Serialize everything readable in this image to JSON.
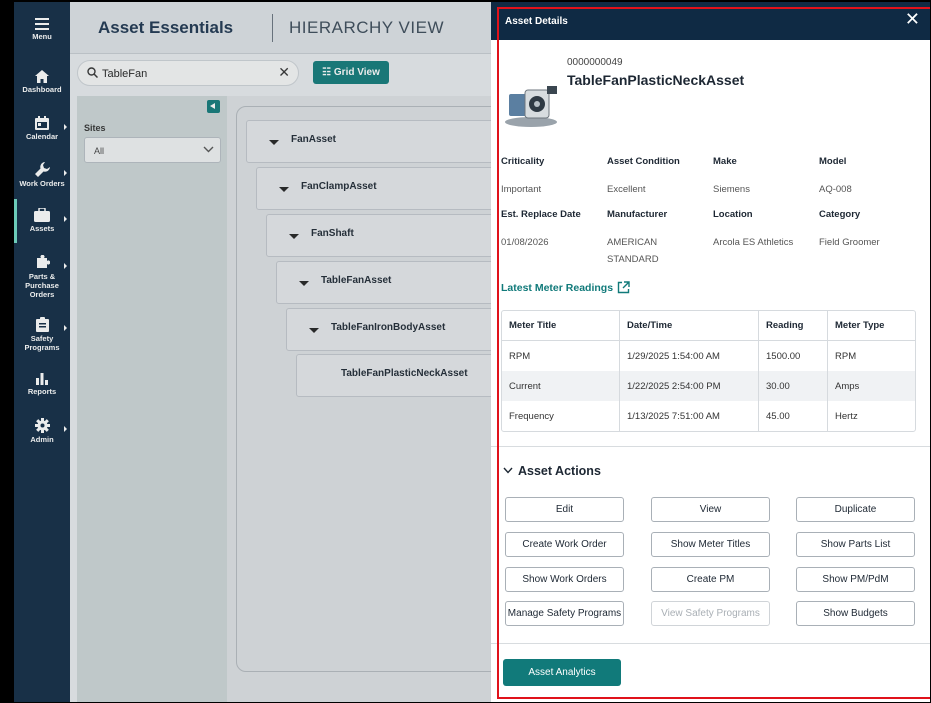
{
  "sidebar": {
    "menu": "Menu",
    "items": [
      {
        "label": "Dashboard",
        "icon": "home-icon"
      },
      {
        "label": "Calendar",
        "icon": "calendar-icon"
      },
      {
        "label": "Work Orders",
        "icon": "wrench-icon"
      },
      {
        "label": "Assets",
        "icon": "briefcase-icon"
      },
      {
        "label": "Parts & Purchase Orders",
        "icon": "puzzle-icon"
      },
      {
        "label": "Safety Programs",
        "icon": "clipboard-icon"
      },
      {
        "label": "Reports",
        "icon": "bar-chart-icon"
      },
      {
        "label": "Admin",
        "icon": "gear-icon"
      }
    ]
  },
  "header": {
    "app_title": "Asset Essentials",
    "view_title": "HIERARCHY VIEW"
  },
  "toolbar": {
    "search_value": "TableFan",
    "clear": "✕",
    "grid_view": "☷ Grid View"
  },
  "filters": {
    "sites_label": "Sites",
    "sites_value": "All"
  },
  "hierarchy": [
    "FanAsset",
    "FanClampAsset",
    "FanShaft",
    "TableFanAsset",
    "TableFanIronBodyAsset",
    "TableFanPlasticNeckAsset"
  ],
  "details": {
    "title": "Asset Details",
    "close": "✕",
    "asset_number": "0000000049",
    "asset_name": "TableFanPlasticNeckAsset",
    "fields": [
      {
        "label": "Criticality",
        "value": "Important"
      },
      {
        "label": "Asset Condition",
        "value": "Excellent"
      },
      {
        "label": "Make",
        "value": "Siemens"
      },
      {
        "label": "Model",
        "value": "AQ-008"
      },
      {
        "label": "Est. Replace Date",
        "value": "01/08/2026"
      },
      {
        "label": "Manufacturer",
        "value": "AMERICAN STANDARD"
      },
      {
        "label": "Location",
        "value": "Arcola ES Athletics"
      },
      {
        "label": "Category",
        "value": "Field Groomer"
      }
    ],
    "meter_link": "Latest Meter Readings",
    "meter_table": {
      "headers": [
        "Meter Title",
        "Date/Time",
        "Reading",
        "Meter Type"
      ],
      "rows": [
        [
          "RPM",
          "1/29/2025 1:54:00 AM",
          "1500.00",
          "RPM"
        ],
        [
          "Current",
          "1/22/2025 2:54:00 PM",
          "30.00",
          "Amps"
        ],
        [
          "Frequency",
          "1/13/2025 7:51:00 AM",
          "45.00",
          "Hertz"
        ]
      ]
    },
    "actions_title": "Asset Actions",
    "actions": [
      "Edit",
      "View",
      "Duplicate",
      "Create Work Order",
      "Show Meter Titles",
      "Show Parts List",
      "Show Work Orders",
      "Create PM",
      "Show PM/PdM",
      "Manage Safety Programs",
      "View Safety Programs",
      "Show Budgets"
    ],
    "analytics": "Asset Analytics"
  },
  "colors": {
    "nav": "#0f2a44",
    "accent": "#117a7a",
    "highlight": "#e0121b"
  }
}
